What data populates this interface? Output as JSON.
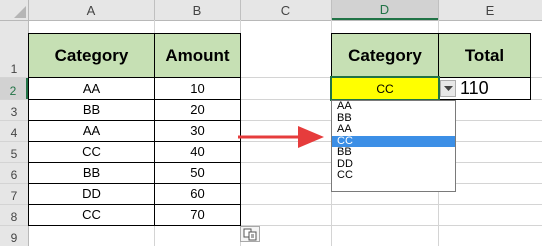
{
  "columns": [
    "A",
    "B",
    "C",
    "D",
    "E"
  ],
  "rows": [
    "1",
    "2",
    "3",
    "4",
    "5",
    "6",
    "7",
    "8",
    "9"
  ],
  "table1": {
    "headers": [
      "Category",
      "Amount"
    ],
    "rows": [
      [
        "AA",
        "10"
      ],
      [
        "BB",
        "20"
      ],
      [
        "AA",
        "30"
      ],
      [
        "CC",
        "40"
      ],
      [
        "BB",
        "50"
      ],
      [
        "DD",
        "60"
      ],
      [
        "CC",
        "70"
      ]
    ]
  },
  "table2": {
    "headers": [
      "Category",
      "Total"
    ],
    "selected_category": "CC",
    "total": "110"
  },
  "dropdown": {
    "options": [
      "AA",
      "BB",
      "AA",
      "CC",
      "BB",
      "DD",
      "CC"
    ],
    "highlighted_index": 3
  },
  "colors": {
    "header_fill": "#c6e0b4",
    "selected_cell_fill": "#ffff00",
    "arrow": "#e63c3c",
    "selection_green": "#217346",
    "list_highlight": "#3c8fe6"
  },
  "icons": [
    "dropdown-arrow-icon",
    "right-arrow-icon",
    "paste-options-icon"
  ]
}
